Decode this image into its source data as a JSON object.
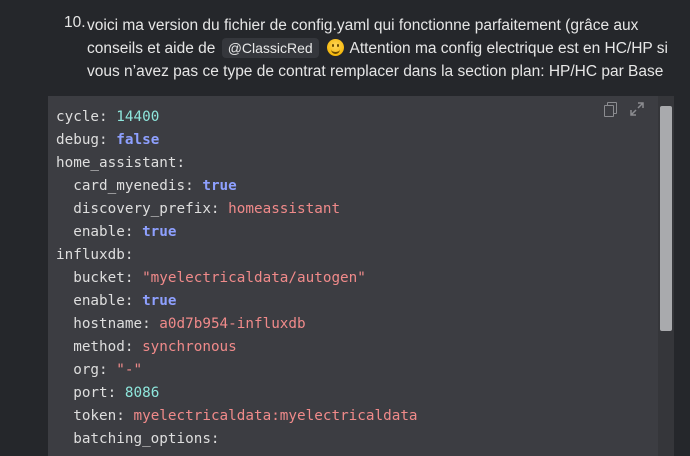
{
  "post": {
    "list_number": "10.",
    "text_before_mention": "voici ma version du fichier de config.yaml qui fonctionne parfaitement (grâce aux conseils et aide de ",
    "mention": "@ClassicRed",
    "emoji": "slightly-smiling-face",
    "text_after_mention": " Attention ma config electrique est en HC/HP si vous n’avez pas ce type de contrat remplacer dans la section plan: HP/HC par Base"
  },
  "code": {
    "lines": [
      {
        "indent": "",
        "key": "cycle:",
        "value": "14400",
        "type": "n"
      },
      {
        "indent": "",
        "key": "debug:",
        "value": "false",
        "type": "b"
      },
      {
        "indent": "",
        "key": "home_assistant:",
        "value": "",
        "type": ""
      },
      {
        "indent": "  ",
        "key": "card_myenedis:",
        "value": "true",
        "type": "b"
      },
      {
        "indent": "  ",
        "key": "discovery_prefix:",
        "value": "homeassistant",
        "type": "s"
      },
      {
        "indent": "  ",
        "key": "enable:",
        "value": "true",
        "type": "b"
      },
      {
        "indent": "",
        "key": "influxdb:",
        "value": "",
        "type": ""
      },
      {
        "indent": "  ",
        "key": "bucket:",
        "value": "\"myelectricaldata/autogen\"",
        "type": "s"
      },
      {
        "indent": "  ",
        "key": "enable:",
        "value": "true",
        "type": "b"
      },
      {
        "indent": "  ",
        "key": "hostname:",
        "value": "a0d7b954-influxdb",
        "type": "s"
      },
      {
        "indent": "  ",
        "key": "method:",
        "value": "synchronous",
        "type": "s"
      },
      {
        "indent": "  ",
        "key": "org:",
        "value": "\"-\"",
        "type": "s"
      },
      {
        "indent": "  ",
        "key": "port:",
        "value": "8086",
        "type": "n"
      },
      {
        "indent": "  ",
        "key": "token:",
        "value": "myelectricaldata:myelectricaldata",
        "type": "s"
      },
      {
        "indent": "  ",
        "key": "batching_options:",
        "value": "",
        "type": ""
      }
    ],
    "toolbar": {
      "copy_icon": "copy-icon",
      "expand_icon": "expand-icon"
    }
  }
}
